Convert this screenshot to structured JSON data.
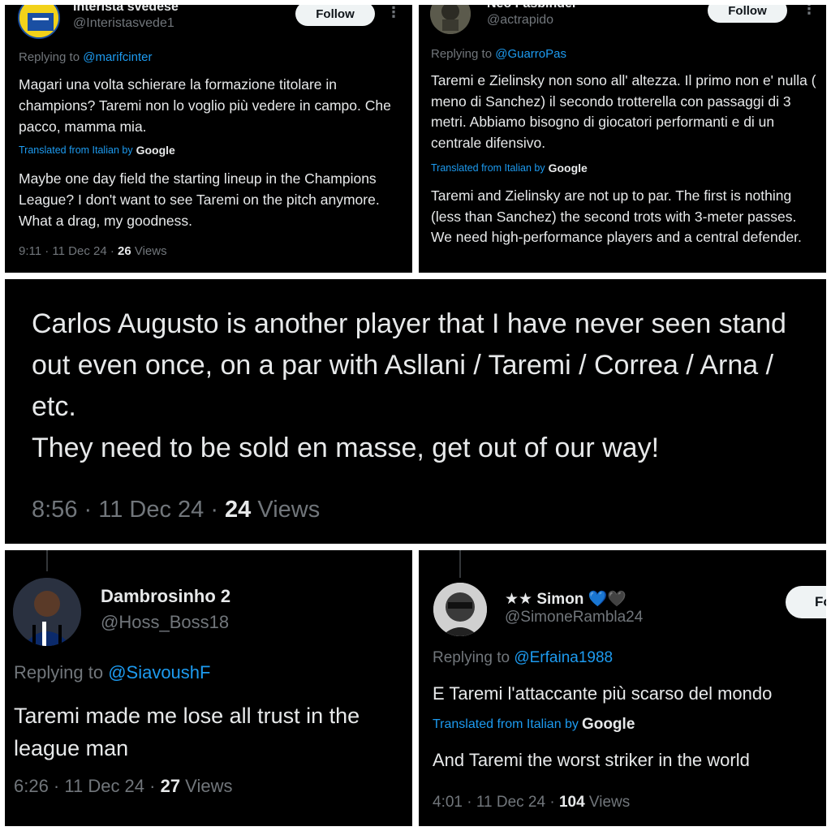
{
  "tweet1": {
    "name": "Interista svedese",
    "handle": "@Interistasvede1",
    "follow_label": "Follow",
    "replying_prefix": "Replying to ",
    "replying_to": "@marifcinter",
    "original_text": "Magari una volta schierare la formazione titolare in champions? Taremi non lo voglio più vedere in campo. Che pacco, mamma mia.",
    "translated_label": "Translated from Italian by",
    "translator": "Google",
    "translation": "Maybe one day field the starting lineup in the Champions League? I don't want to see Taremi on the pitch anymore. What a drag, my goodness.",
    "time": "9:11 · 11 Dec 24 · ",
    "views_count": "26",
    "views_label": " Views"
  },
  "tweet2": {
    "name": "Neo Fasbinder",
    "handle": "@actrapido",
    "follow_label": "Follow",
    "replying_prefix": "Replying to ",
    "replying_to": "@GuarroPas",
    "original_text": "Taremi e Zielinsky non sono all' altezza. Il primo non e' nulla ( meno di Sanchez) il secondo trotterella con passaggi di 3 metri. Abbiamo bisogno di giocatori performanti  e di un centrale difensivo.",
    "translated_label": "Translated from Italian by",
    "translator": "Google",
    "translation": "Taremi and Zielinsky are not up to par. The first is nothing (less than Sanchez) the second trots with 3-meter passes. We need high-performance players and a central defender."
  },
  "tweet3": {
    "text": "Carlos Augusto is another player that I have never seen stand out even once, on a par with Asllani / Taremi / Correa / Arna / etc.\nThey need to be sold en masse, get out of our way!",
    "time": "8:56 · 11 Dec 24 · ",
    "views_count": "24",
    "views_label": " Views"
  },
  "tweet4": {
    "name": "Dambrosinho 2",
    "handle": "@Hoss_Boss18",
    "replying_prefix": "Replying to ",
    "replying_to": "@SiavoushF",
    "text": "Taremi made me lose all trust in the league man",
    "time": "6:26 · 11 Dec 24 · ",
    "views_count": "27",
    "views_label": " Views"
  },
  "tweet5": {
    "name": "★★ Simon 💙🖤",
    "handle": "@SimoneRambla24",
    "follow_label": "Fo",
    "replying_prefix": "Replying to ",
    "replying_to": "@Erfaina1988",
    "original_text": "E Taremi l'attaccante più scarso del mondo",
    "translated_label": "Translated from Italian by",
    "translator": "Google",
    "translation": "And Taremi the worst striker in the world",
    "time": "4:01 · 11 Dec 24 · ",
    "views_count": "104",
    "views_label": " Views"
  },
  "colors": {
    "background": "#000000",
    "text": "#e7e9ea",
    "muted": "#71767b",
    "link": "#1d9bf0"
  }
}
